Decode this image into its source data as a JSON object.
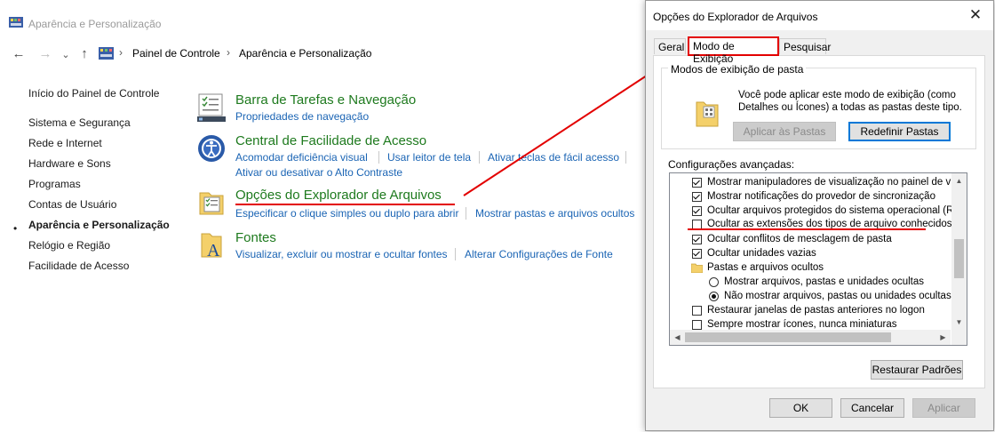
{
  "control_panel": {
    "window_title": "Aparência e Personalização",
    "breadcrumb": [
      "Painel de Controle",
      "Aparência e Personalização"
    ],
    "nav": {
      "back": "←",
      "forward": "→",
      "up": "↑"
    },
    "sidebar": {
      "items": [
        {
          "label": "Início do Painel de Controle"
        },
        {
          "label": "Sistema e Segurança"
        },
        {
          "label": "Rede e Internet"
        },
        {
          "label": "Hardware e Sons"
        },
        {
          "label": "Programas"
        },
        {
          "label": "Contas de Usuário"
        },
        {
          "label": "Aparência e Personalização",
          "active": true
        },
        {
          "label": "Relógio e Região"
        },
        {
          "label": "Facilidade de Acesso"
        }
      ],
      "active_bullet": "•"
    },
    "categories": [
      {
        "title": "Barra de Tarefas e Navegação",
        "icon": "taskbar-icon",
        "links": [
          "Propriedades de navegação"
        ]
      },
      {
        "title": "Central de Facilidade de Acesso",
        "icon": "ease-of-access-icon",
        "links": [
          "Acomodar deficiência visual",
          "Usar leitor de tela",
          "Ativar teclas de fácil acesso",
          "Ativar ou desativar o Alto Contraste"
        ]
      },
      {
        "title": "Opções do Explorador de Arquivos",
        "icon": "folder-options-icon",
        "links": [
          "Especificar o clique simples ou duplo para abrir",
          "Mostrar pastas e arquivos ocultos"
        ]
      },
      {
        "title": "Fontes",
        "icon": "fonts-icon",
        "links": [
          "Visualizar, excluir ou mostrar e ocultar fontes",
          "Alterar Configurações de Fonte"
        ]
      }
    ]
  },
  "dialog": {
    "title": "Opções do Explorador de Arquivos",
    "close": "✕",
    "tabs": [
      "Geral",
      "Modo de Exibição",
      "Pesquisar"
    ],
    "active_tab": "Modo de Exibição",
    "folder_views": {
      "label": "Modos de exibição de pasta",
      "description": "Você pode aplicar este modo de exibição (como Detalhes ou Ícones) a todas as pastas deste tipo.",
      "apply_button": "Aplicar às Pastas",
      "reset_button": "Redefinir Pastas"
    },
    "advanced_label": "Configurações avançadas:",
    "advanced_items": [
      {
        "type": "checkbox",
        "checked": true,
        "indent": 0,
        "label": "Mostrar manipuladores de visualização no painel de visua"
      },
      {
        "type": "checkbox",
        "checked": true,
        "indent": 0,
        "label": "Mostrar notificações do provedor de sincronização"
      },
      {
        "type": "checkbox",
        "checked": true,
        "indent": 0,
        "label": "Ocultar arquivos protegidos do sistema operacional (Reco"
      },
      {
        "type": "checkbox",
        "checked": false,
        "indent": 0,
        "label": "Ocultar as extensões dos tipos de arquivo conhecidos"
      },
      {
        "type": "checkbox",
        "checked": true,
        "indent": 0,
        "label": "Ocultar conflitos de mesclagem de pasta"
      },
      {
        "type": "checkbox",
        "checked": true,
        "indent": 0,
        "label": "Ocultar unidades vazias"
      },
      {
        "type": "folder",
        "indent": 0,
        "label": "Pastas e arquivos ocultos"
      },
      {
        "type": "radio",
        "checked": false,
        "indent": 1,
        "label": "Mostrar arquivos, pastas e unidades ocultas"
      },
      {
        "type": "radio",
        "checked": true,
        "indent": 1,
        "label": "Não mostrar arquivos, pastas ou unidades ocultas"
      },
      {
        "type": "checkbox",
        "checked": false,
        "indent": 0,
        "label": "Restaurar janelas de pastas anteriores no logon"
      },
      {
        "type": "checkbox",
        "checked": false,
        "indent": 0,
        "label": "Sempre mostrar ícones, nunca miniaturas"
      }
    ],
    "restore_defaults_button": "Restaurar Padrões",
    "ok_button": "OK",
    "cancel_button": "Cancelar",
    "apply_button": "Aplicar",
    "scroll_glyphs": {
      "up": "▲",
      "down": "▼",
      "left": "◀",
      "right": "▶"
    }
  },
  "annotation_colors": {
    "red": "#e30000",
    "link": "#1a64b4",
    "heading": "#1e7a1e"
  }
}
